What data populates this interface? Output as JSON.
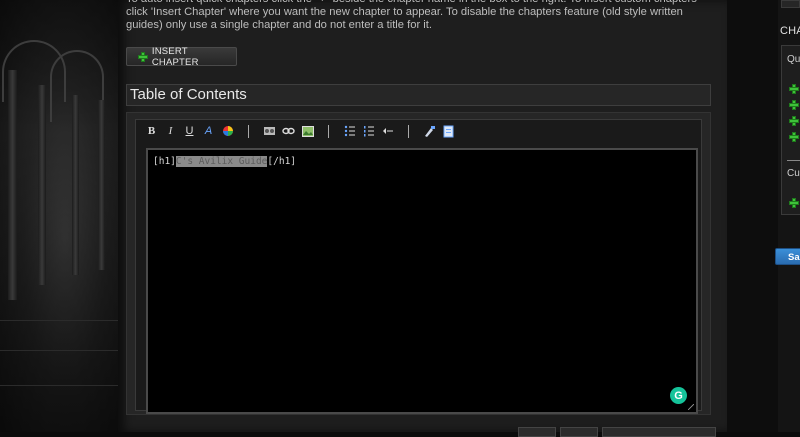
{
  "intro": {
    "text": "To auto insert quick chapters click the \"+\" beside the chapter name in the box to the right. To insert custom chapters click 'Insert Chapter' where you want the new chapter to appear. To disable the chapters feature (old style written guides) only use a single chapter and do not enter a title for it."
  },
  "insert_chapter_label": "INSERT CHAPTER",
  "toc_title": "Table of Contents",
  "toolbar": {
    "bold": "B",
    "italic": "I",
    "underline": "U",
    "font": "A",
    "icons": [
      "bold-icon",
      "italic-icon",
      "underline-icon",
      "font-icon",
      "color-icon",
      "media-icon",
      "link-icon",
      "image-icon",
      "bullet-list-icon",
      "numbered-list-icon",
      "indent-icon",
      "format-icon",
      "source-icon"
    ]
  },
  "editor": {
    "open_tag": "[h1]",
    "selected": "C's Avilix Guide",
    "close_tag": "[/h1]"
  },
  "right": {
    "chapters_label": "CHA",
    "qu_label": "Qu",
    "cu_label": "Cu",
    "save_label": "Sa"
  },
  "colors": {
    "accent_green": "#3ec13a",
    "save_blue": "#3b8fd8",
    "grammarly": "#15c39a"
  }
}
